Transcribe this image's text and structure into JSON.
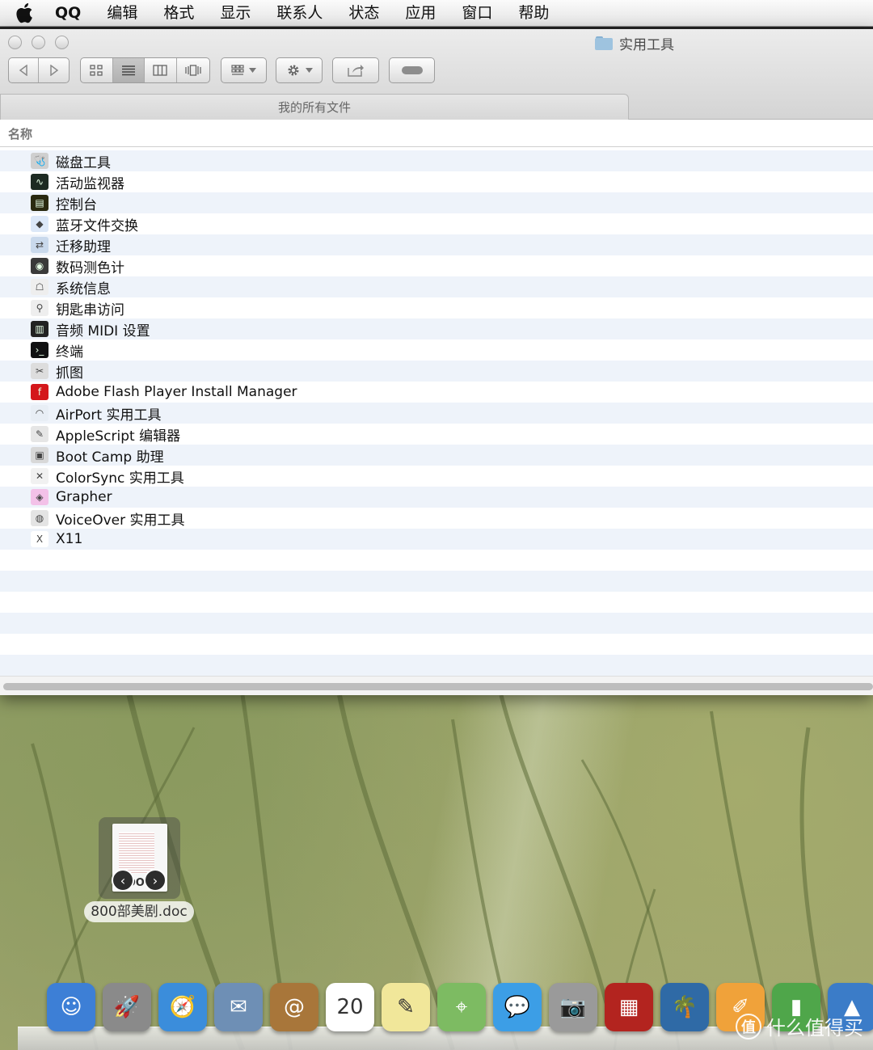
{
  "menubar": {
    "apple_icon": "apple-icon",
    "items": [
      "QQ",
      "编辑",
      "格式",
      "显示",
      "联系人",
      "状态",
      "应用",
      "窗口",
      "帮助"
    ]
  },
  "window": {
    "title": "实用工具",
    "tab": "我的所有文件",
    "column_name": "名称",
    "files": [
      {
        "name": "磁盘工具",
        "icon": "disk-utility-icon",
        "color": "#cfcfcf",
        "glyph": "🩺"
      },
      {
        "name": "活动监视器",
        "icon": "activity-monitor-icon",
        "color": "#1d2a22",
        "glyph": "∿"
      },
      {
        "name": "控制台",
        "icon": "console-icon",
        "color": "#2a2a10",
        "glyph": "▤"
      },
      {
        "name": "蓝牙文件交换",
        "icon": "bluetooth-icon",
        "color": "#dce8f8",
        "glyph": "◆"
      },
      {
        "name": "迁移助理",
        "icon": "migration-icon",
        "color": "#c9d9ec",
        "glyph": "⇄"
      },
      {
        "name": "数码测色计",
        "icon": "color-meter-icon",
        "color": "#3a3a3a",
        "glyph": "◉"
      },
      {
        "name": "系统信息",
        "icon": "system-info-icon",
        "color": "#eeeeee",
        "glyph": "☖"
      },
      {
        "name": "钥匙串访问",
        "icon": "keychain-icon",
        "color": "#eeeeee",
        "glyph": "⚲"
      },
      {
        "name": "音频 MIDI 设置",
        "icon": "midi-icon",
        "color": "#222222",
        "glyph": "▥"
      },
      {
        "name": "终端",
        "icon": "terminal-icon",
        "color": "#111111",
        "glyph": "›_"
      },
      {
        "name": "抓图",
        "icon": "grab-icon",
        "color": "#dddddd",
        "glyph": "✂"
      },
      {
        "name": "Adobe Flash Player Install Manager",
        "icon": "flash-icon",
        "color": "#d4171b",
        "glyph": "f"
      },
      {
        "name": "AirPort 实用工具",
        "icon": "airport-icon",
        "color": "#e8eef5",
        "glyph": "◠"
      },
      {
        "name": "AppleScript 编辑器",
        "icon": "applescript-icon",
        "color": "#e6e6e6",
        "glyph": "✎"
      },
      {
        "name": "Boot Camp 助理",
        "icon": "bootcamp-icon",
        "color": "#d8d8d8",
        "glyph": "▣"
      },
      {
        "name": "ColorSync 实用工具",
        "icon": "colorsync-icon",
        "color": "#f1f1f1",
        "glyph": "✕"
      },
      {
        "name": "Grapher",
        "icon": "grapher-icon",
        "color": "#f3c1e8",
        "glyph": "◈"
      },
      {
        "name": "VoiceOver 实用工具",
        "icon": "voiceover-icon",
        "color": "#e4e4e4",
        "glyph": "◍"
      },
      {
        "name": "X11",
        "icon": "x11-icon",
        "color": "#ffffff",
        "glyph": "X"
      }
    ]
  },
  "desktop": {
    "file_name": "800部美剧.doc",
    "file_ext": "DO"
  },
  "dock": {
    "apps": [
      {
        "name": "finder-icon",
        "color": "#3d7fd6",
        "glyph": "☺"
      },
      {
        "name": "launchpad-icon",
        "color": "#8a8a8a",
        "glyph": "🚀"
      },
      {
        "name": "safari-icon",
        "color": "#3b8ddb",
        "glyph": "🧭"
      },
      {
        "name": "mail-icon",
        "color": "#6e8fb5",
        "glyph": "✉"
      },
      {
        "name": "contacts-icon",
        "color": "#a8763a",
        "glyph": "@"
      },
      {
        "name": "calendar-icon",
        "color": "#ffffff",
        "glyph": "20"
      },
      {
        "name": "notes-icon",
        "color": "#f1e79a",
        "glyph": "✎"
      },
      {
        "name": "maps-icon",
        "color": "#7dbb62",
        "glyph": "⌖"
      },
      {
        "name": "messages-icon",
        "color": "#3c9ee6",
        "glyph": "💬"
      },
      {
        "name": "facetime-icon",
        "color": "#9a9a9a",
        "glyph": "📷"
      },
      {
        "name": "photo-booth-icon",
        "color": "#b3241f",
        "glyph": "▦"
      },
      {
        "name": "iphoto-icon",
        "color": "#2f6aa6",
        "glyph": "🌴"
      },
      {
        "name": "pages-icon",
        "color": "#f0a23a",
        "glyph": "✐"
      },
      {
        "name": "numbers-icon",
        "color": "#4fa64a",
        "glyph": "▮"
      },
      {
        "name": "keynote-icon",
        "color": "#3b7cc8",
        "glyph": "▲"
      }
    ],
    "watermark_text": "什么值得买",
    "watermark_badge": "值"
  }
}
